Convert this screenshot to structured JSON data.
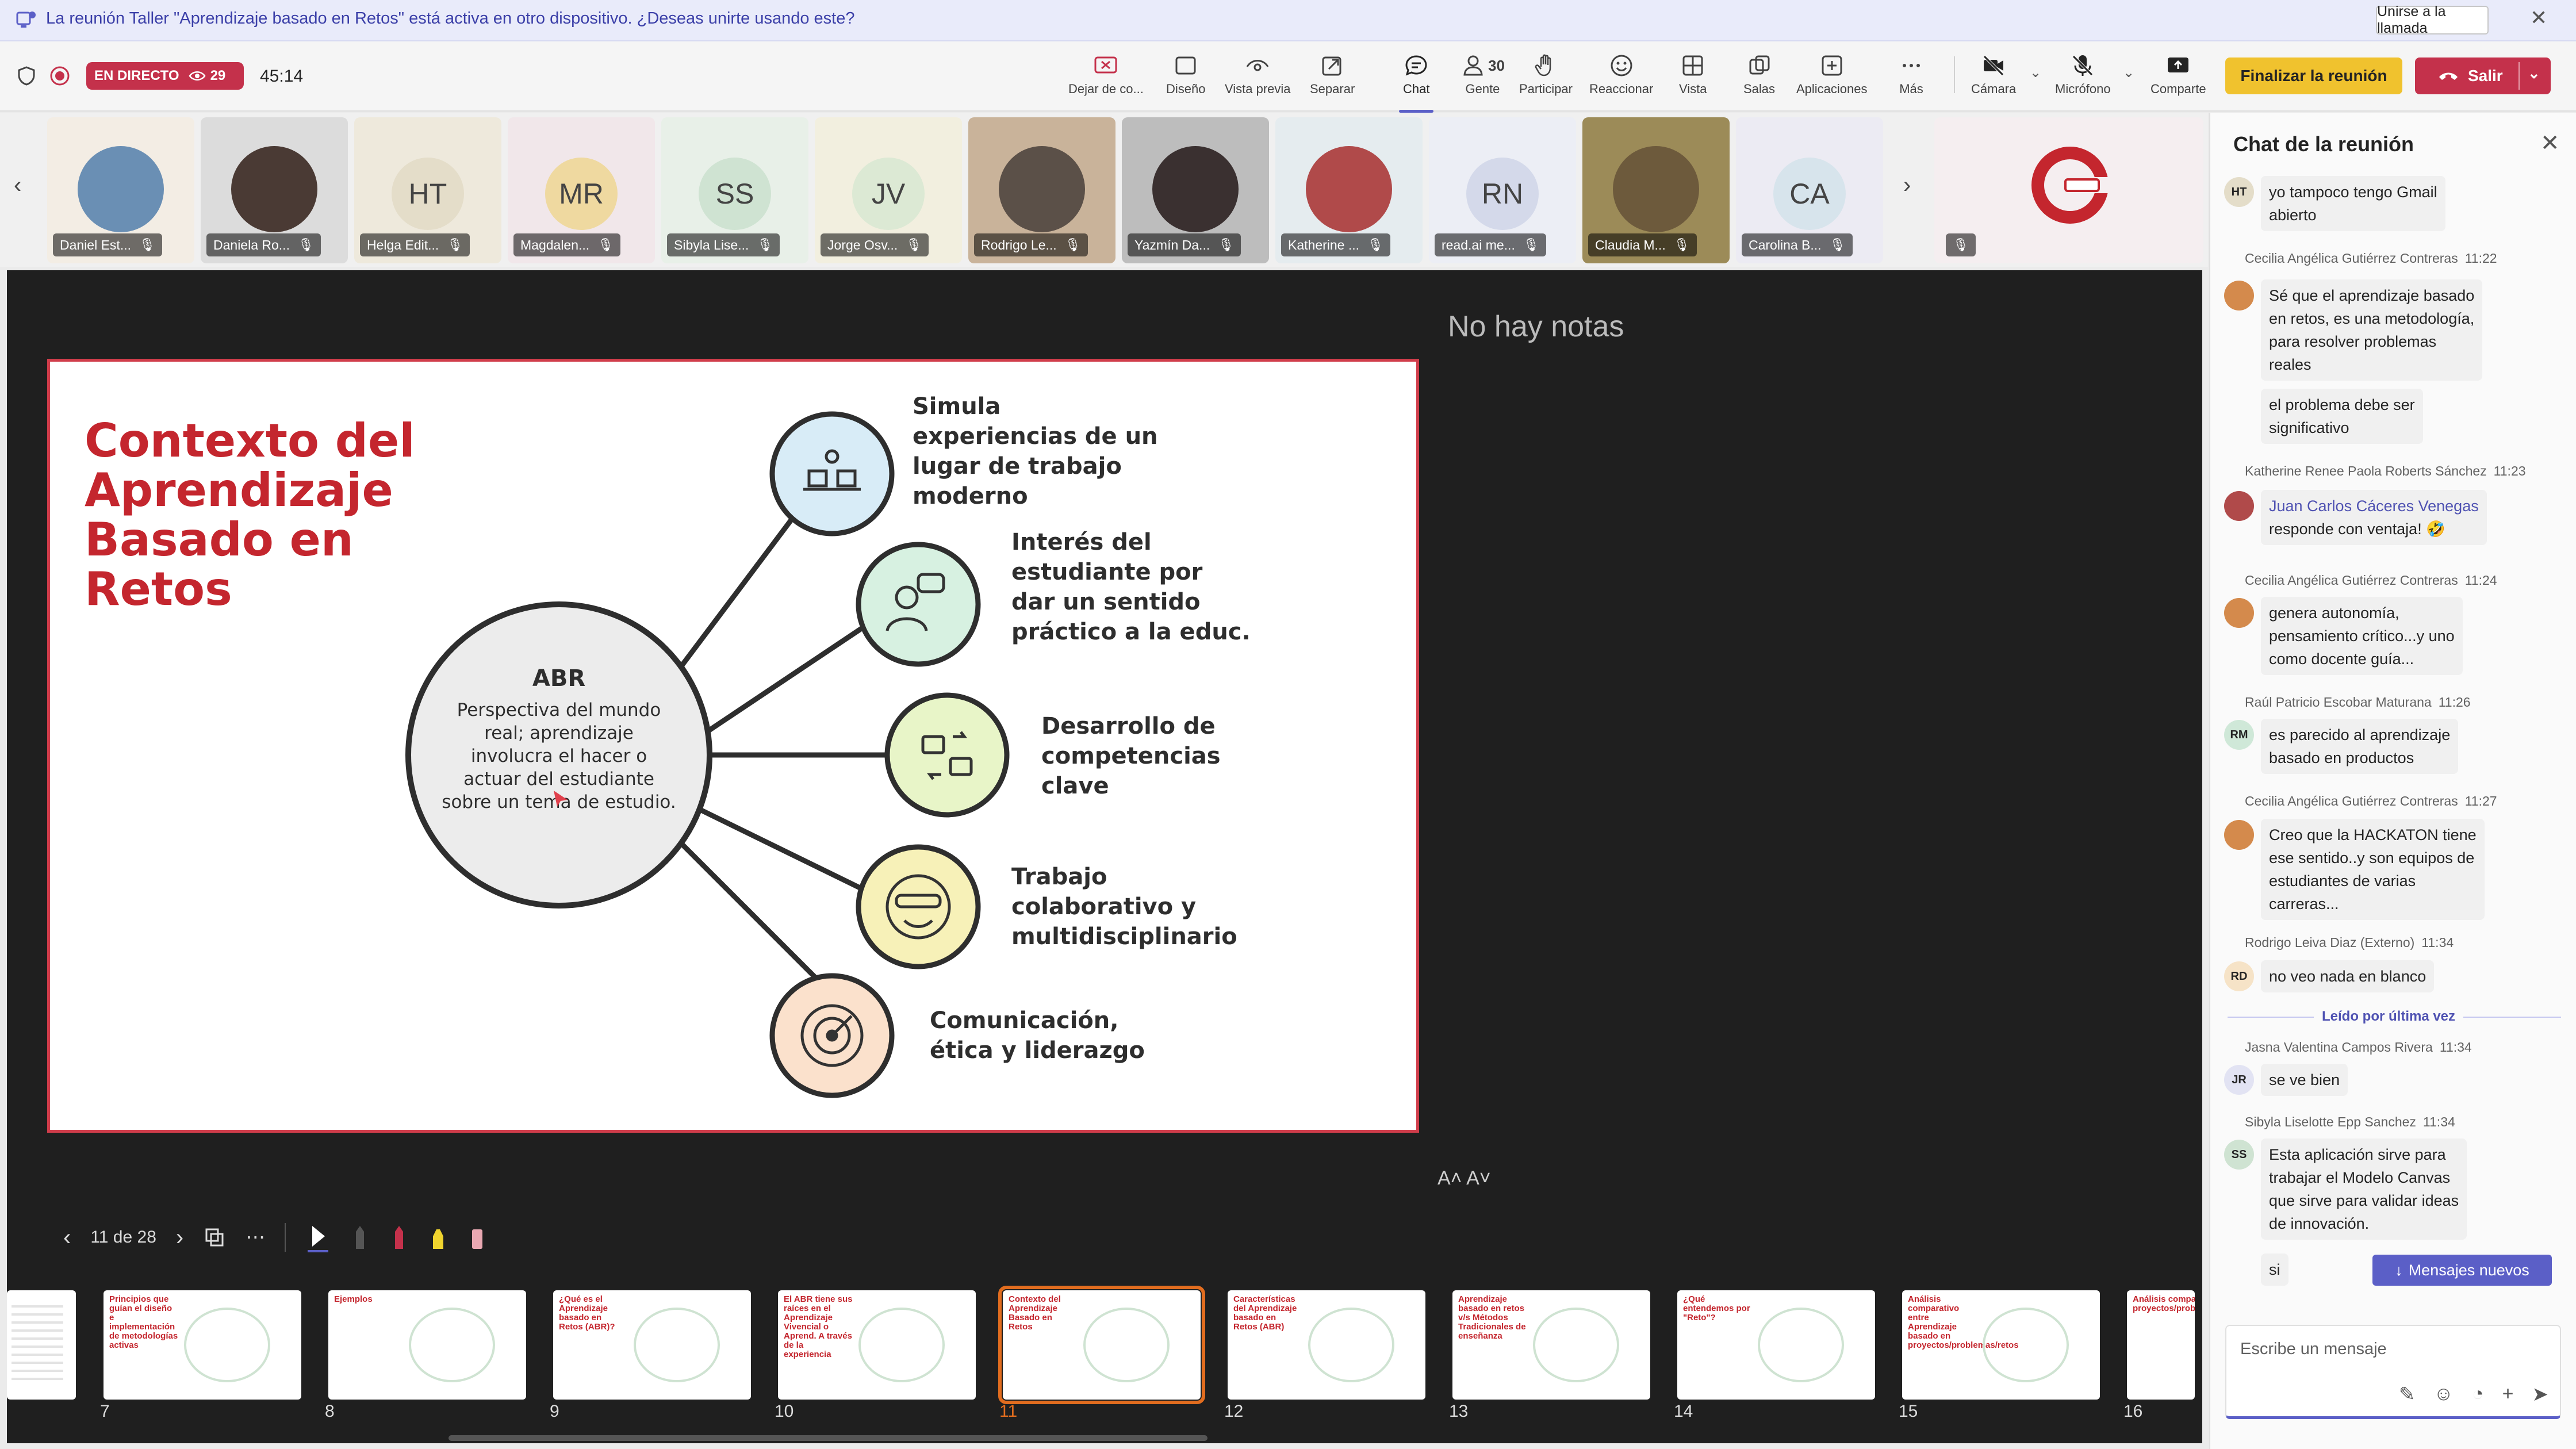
{
  "banner": {
    "text": "La reunión Taller \"Aprendizaje basado en Retos\" está activa en otro dispositivo. ¿Deseas unirte usando este?",
    "join_label": "Unirse a la llamada"
  },
  "header": {
    "live_label": "EN DIRECTO",
    "viewer_count": "29",
    "timer": "45:14",
    "toolbar": [
      {
        "id": "stop",
        "label": "Dejar de co..."
      },
      {
        "id": "layout",
        "label": "Diseño"
      },
      {
        "id": "preview",
        "label": "Vista previa"
      },
      {
        "id": "popout",
        "label": "Separar"
      },
      {
        "id": "chat",
        "label": "Chat"
      },
      {
        "id": "people",
        "label": "Gente",
        "count": "30"
      },
      {
        "id": "raise",
        "label": "Participar"
      },
      {
        "id": "react",
        "label": "Reaccionar"
      },
      {
        "id": "view",
        "label": "Vista"
      },
      {
        "id": "rooms",
        "label": "Salas"
      },
      {
        "id": "apps",
        "label": "Aplicaciones"
      },
      {
        "id": "more",
        "label": "Más"
      },
      {
        "id": "camera",
        "label": "Cámara"
      },
      {
        "id": "mic",
        "label": "Micrófono"
      },
      {
        "id": "share",
        "label": "Comparte"
      }
    ],
    "end_label": "Finalizar la reunión",
    "leave_label": "Salir"
  },
  "participants": [
    {
      "name": "Daniel Est...",
      "initials": "",
      "bg": "#f3ede4",
      "avatar": "#6a8fb4"
    },
    {
      "name": "Daniela Ro...",
      "initials": "",
      "bg": "#dcdcdc",
      "avatar": "#4a3a34"
    },
    {
      "name": "Helga Edit...",
      "initials": "HT",
      "bg": "#eee9dc",
      "avatar": "#e4ddc9"
    },
    {
      "name": "Magdalen...",
      "initials": "MR",
      "bg": "#f1e7ea",
      "avatar": "#efd9a0"
    },
    {
      "name": "Sibyla Lise...",
      "initials": "SS",
      "bg": "#e8f0e8",
      "avatar": "#cfe3d2"
    },
    {
      "name": "Jorge Osv...",
      "initials": "JV",
      "bg": "#f2efdf",
      "avatar": "#dce9d4"
    },
    {
      "name": "Rodrigo Le...",
      "initials": "",
      "bg": "#c9b39a",
      "avatar": "#5b5048"
    },
    {
      "name": "Yazmín Da...",
      "initials": "",
      "bg": "#bdbdbd",
      "avatar": "#3a3030"
    },
    {
      "name": "Katherine ...",
      "initials": "",
      "bg": "#e5ecef",
      "avatar": "#b04a4a"
    },
    {
      "name": "read.ai me...",
      "initials": "RN",
      "bg": "#eceef5",
      "avatar": "#d4d9ea"
    },
    {
      "name": "Claudia M...",
      "initials": "",
      "bg": "#9c8b58",
      "avatar": "#6d5a3c"
    },
    {
      "name": "Carolina B...",
      "initials": "CA",
      "bg": "#ecebf3",
      "avatar": "#d7e4ec"
    }
  ],
  "stage": {
    "no_notes": "No hay notas",
    "slide": {
      "title": "Contexto del Aprendizaje Basado en Retos",
      "hub_title": "ABR",
      "hub_text": "Perspectiva del mundo real; aprendizaje involucra el hacer o actuar del estudiante sobre un tema de estudio.",
      "items": [
        {
          "text": "Simula experiencias de un lugar de trabajo moderno",
          "color": "#d8ecf7",
          "icon": "workplace-icon"
        },
        {
          "text": "Interés del estudiante por dar un sentido práctico a la educ.",
          "color": "#d7f1e1",
          "icon": "student-idea-icon"
        },
        {
          "text": "Desarrollo de competencias clave",
          "color": "#e8f5c8",
          "icon": "briefcase-exchange-icon"
        },
        {
          "text": "Trabajo colaborativo y multidisciplinario",
          "color": "#f7f1b8",
          "icon": "team-face-icon"
        },
        {
          "text": "Comunicación, ética y liderazgo",
          "color": "#fbe1cc",
          "icon": "target-icon"
        }
      ]
    },
    "page_indicator": "11 de 28",
    "zoom_label": "A˄ A˅"
  },
  "thumbnails": [
    {
      "num": "7",
      "title": "Principios que guían el diseño e implementación de metodologías activas"
    },
    {
      "num": "8",
      "title": "Ejemplos"
    },
    {
      "num": "9",
      "title": "¿Qué es el Aprendizaje basado en Retos (ABR)?"
    },
    {
      "num": "10",
      "title": "El ABR tiene sus raíces en el Aprendizaje Vivencial o Aprend. A través de la experiencia"
    },
    {
      "num": "11",
      "title": "Contexto del Aprendizaje Basado en Retos"
    },
    {
      "num": "12",
      "title": "Características del Aprendizaje basado en Retos (ABR)"
    },
    {
      "num": "13",
      "title": "Aprendizaje basado en retos v/s Métodos Tradicionales de enseñanza"
    },
    {
      "num": "14",
      "title": "¿Qué entendemos por \"Reto\"?"
    },
    {
      "num": "15",
      "title": "Análisis comparativo entre Aprendizaje basado en proyectos/problemas/retos"
    },
    {
      "num": "16",
      "title": "Análisis compa proyectos/probl"
    }
  ],
  "chat": {
    "title": "Chat de la reunión",
    "messages": [
      {
        "author": "",
        "time": "",
        "initials": "HT",
        "avcolor": "#e4ddc9",
        "lines": [
          "yo tampoco tengo Gmail",
          "abierto"
        ]
      },
      {
        "author": "Cecilia Angélica Gutiérrez Contreras",
        "time": "11:22",
        "initials": "",
        "avcolor": "#d48a4c",
        "lines": [
          "Sé que el aprendizaje basado",
          "en retos, es una metodología,",
          "para resolver problemas",
          "reales"
        ]
      },
      {
        "author": "",
        "time": "",
        "initials": "",
        "avcolor": "",
        "lines": [
          "el problema debe ser",
          "significativo"
        ]
      },
      {
        "author": "Katherine Renee Paola Roberts Sánchez",
        "time": "11:23",
        "initials": "",
        "avcolor": "#b04a4a",
        "mention": "Juan Carlos Cáceres Venegas",
        "lines": [
          "responde con ventaja! 🤣"
        ]
      },
      {
        "author": "Cecilia Angélica Gutiérrez Contreras",
        "time": "11:24",
        "initials": "",
        "avcolor": "#d48a4c",
        "lines": [
          "genera autonomía,",
          "pensamiento crítico...y uno",
          "como docente guía..."
        ]
      },
      {
        "author": "Raúl Patricio Escobar Maturana",
        "time": "11:26",
        "initials": "RM",
        "avcolor": "#cfe8d8",
        "lines": [
          "es parecido al aprendizaje",
          "basado en productos"
        ]
      },
      {
        "author": "Cecilia Angélica Gutiérrez Contreras",
        "time": "11:27",
        "initials": "",
        "avcolor": "#d48a4c",
        "lines": [
          "Creo que la HACKATON tiene",
          "ese sentido..y son equipos de",
          "estudiantes de varias",
          "carreras..."
        ]
      },
      {
        "author": "Rodrigo Leiva Diaz (Externo)",
        "time": "11:34",
        "initials": "RD",
        "avcolor": "#f6e3c7",
        "lines": [
          "no veo nada en blanco"
        ]
      },
      {
        "author": "Jasna Valentina Campos Rivera",
        "time": "11:34",
        "initials": "JR",
        "avcolor": "#e2e3f3",
        "lines": [
          "se ve bien"
        ]
      },
      {
        "author": "Sibyla Liselotte Epp Sanchez",
        "time": "11:34",
        "initials": "SS",
        "avcolor": "#cfe3d2",
        "lines": [
          "Esta aplicación sirve para",
          "trabajar el Modelo Canvas",
          "que sirve para validar ideas",
          "de innovación."
        ]
      },
      {
        "author": "",
        "time": "",
        "initials": "",
        "avcolor": "",
        "lines": [
          "si"
        ]
      }
    ],
    "last_read_label": "Leído por última vez",
    "new_messages_label": "Mensajes nuevos",
    "composer_placeholder": "Escribe un mensaje"
  }
}
